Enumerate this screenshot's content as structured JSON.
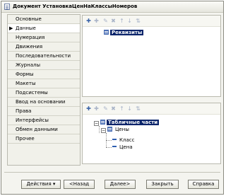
{
  "window": {
    "title": "Документ УстановкаЦенНаКлассыНомеров"
  },
  "sidebar": {
    "items": [
      {
        "label": "Основные"
      },
      {
        "label": "Данные",
        "active": true
      },
      {
        "label": "Нумерация"
      },
      {
        "label": "Движения"
      },
      {
        "label": "Последовательности"
      },
      {
        "label": "Журналы"
      },
      {
        "label": "Формы"
      },
      {
        "label": "Макеты"
      },
      {
        "label": "Подсистемы"
      },
      {
        "label": "Ввод на основании"
      },
      {
        "label": "Права"
      },
      {
        "label": "Интерфейсы"
      },
      {
        "label": "Обмен данными"
      },
      {
        "label": "Прочее"
      }
    ],
    "active_marker": "▶"
  },
  "attributes_panel": {
    "root": "Реквизиты"
  },
  "tabular_panel": {
    "root": "Табличные части",
    "table": "Цены",
    "columns": [
      "Класс",
      "Цена"
    ],
    "expander_open": "−"
  },
  "buttons": {
    "actions": "Действия",
    "back": "<Назад",
    "next": "Далее>",
    "close": "Закрыть",
    "help": "Справка",
    "dropdown_glyph": "▾"
  },
  "colors": {
    "selection": "#0a246a",
    "icon_blue": "#3a63a8",
    "window_bg": "#f4f4ef"
  }
}
